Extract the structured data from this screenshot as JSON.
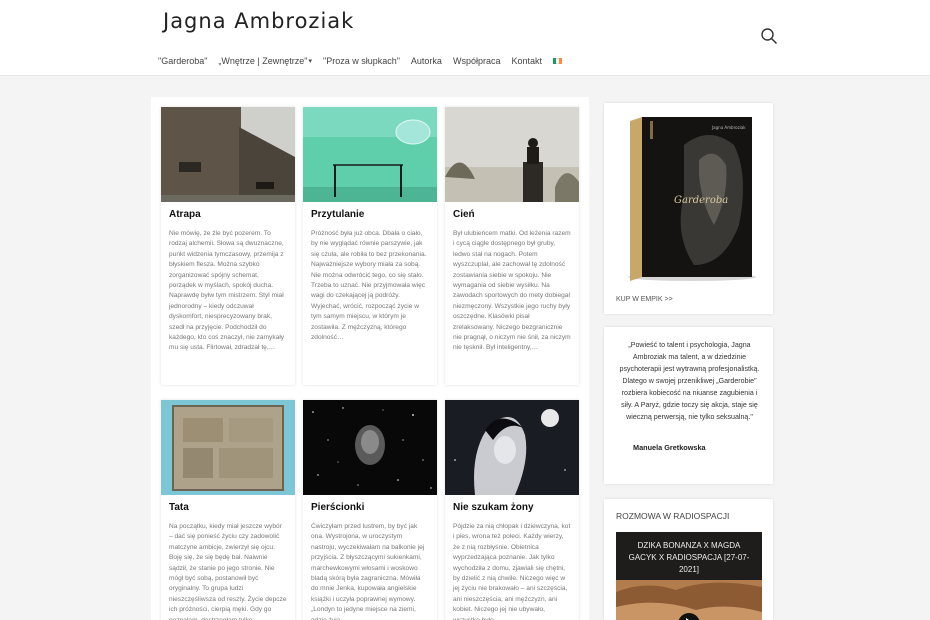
{
  "header": {
    "site_title": "Jagna Ambroziak",
    "search_icon": "magnifier"
  },
  "nav": [
    {
      "label": "\"Garderoba\""
    },
    {
      "label": "„Wnętrze | Zewnętrze\"",
      "has_dropdown": true
    },
    {
      "label": "\"Proza w słupkach\""
    },
    {
      "label": "Autorka"
    },
    {
      "label": "Współpraca"
    },
    {
      "label": "Kontakt"
    }
  ],
  "language_flag": {
    "colors": [
      "#169b62",
      "#ffffff",
      "#ff883e"
    ]
  },
  "posts": [
    {
      "title": "Atrapa",
      "excerpt": "Nie mówię, że źle być pozerem. To rodzaj alchemii. Słowa są dwuznaczne, punkt widzenia tymczasowy, przemija z błyskiem flesza. Można szybko zorganizować spójny schemat, porządek w myślach, spokój ducha. Naprawdę byłw tym mistrzem. Styl miał jednorodny – kiedy odczuwał dyskomfort, niesprecyzowany brak, szedł na przyjęcie. Podchodził do każdego, kto coś znaczył, nie zamykały mu się usta. Flirtował, zdradzał tę,…"
    },
    {
      "title": "Przytulanie",
      "excerpt": "Próżność była już obca. Dbała o ciało, by nie wyglądać równie parszywie, jak się czuła, ale robiła to bez przekonania. Najważniejsze wybory miała za sobą. Nie można odwrócić tego, co się stało. Trzeba to uznać. Nie przyjmowała więc wagi do czekającej ją podróży. Wyjechać, wrócić, rozpocząć życie w tym samym miejscu, w którym je zostawiła. Z mężczyzną, którego zdolność…"
    },
    {
      "title": "Cień",
      "excerpt": "Był ulubieńcem matki. Od leżenia razem i cycą ciągle dostępnego był gruby, ledwo stał na nogach. Potem wyszczuplał, ale zachował tę zdolność zostawiania siebie w spokoju. Nie wymagania od siebie wysiłku. Na zawodach sportowych do mety dobiegał niezmęczony. Wszystkie jego ruchy były oszczędne. Klasówki pisał zrelaksowany. Niczego bezgranicznie nie pragnął, o niczym nie śnił, za niczym nie tęsknił. Był inteligentny,…"
    },
    {
      "title": "Tata",
      "excerpt": "Na początku, kiedy miał jeszcze wybór – dać się ponieść życiu czy zadowolić matczyne ambicje, zwierzył się ojcu: Boję się, że się będę bał. Naiwnie sądził, że stanie po jego stronie. Nie mógł być sobą, postanowił być oryginalny. To grupa ludzi nieszczęśliwsza od reszty. Życie depcze ich próżności, cierpią męki. Gdy go poznałam, dostrzegłam tylko…"
    },
    {
      "title": "Pierścionki",
      "excerpt": "Ćwiczyłam przed lustrem, by być jak ona. Wystrojona, w uroczystym nastroju, wyczekiwałam na balkonie jej przyjścia. Z błyszczącymi sukienkami, marchewkowymi włosami i woskowo bladą skórą była zagraniczna. Mówiła do mnie Jenka, kupowała angielskie książki i uczyła poprawnej wymowy. „Londyn to jedyne miejsce na ziemi, gdzie żyją…"
    },
    {
      "title": "Nie szukam żony",
      "excerpt": "Pójdzie za nią chłopak i dziewczyna, kot i pies, wrona też poleci. Każdy wierzy, że z nią rozbłyśnie. Obietnica wyprzedzająca poznanie. Jak tylko wychodziła z domu, zjawiali się chętni, by dzielić z nią chwile. Niczego więc w jej życiu nie brakowało – ani szczęścia, ani nieszczęścia, ani mężczyzn, ani kobiet. Niczego jej nie ubywało, wszystko było…"
    }
  ],
  "sidebar": {
    "book": {
      "cover_title": "Garderoba",
      "cover_author": "Jagna Ambroziak",
      "buy_link": "KUP W EMPIK >>"
    },
    "quote": {
      "text": "„Powieść to talent i psychologia, Jagna Ambroziak ma talent, a w dziedzinie psychoterapii jest wytrawną profesjonalistką. Dlatego w swojej przenikliwej „Garderobie\" rozbiera kobiecość na niuanse zagubienia i siły. A Paryż, gdzie toczy się akcja, staje się wieczną perwersją, nie tylko seksualną.\"",
      "author": "Manuela Gretkowska"
    },
    "radio": {
      "title": "ROZMOWA W RADIOSPACJI",
      "video_title": "DZIKA BONANZA X MAGDA GACYK X RADIOSPACJA [27-07-2021]"
    }
  }
}
